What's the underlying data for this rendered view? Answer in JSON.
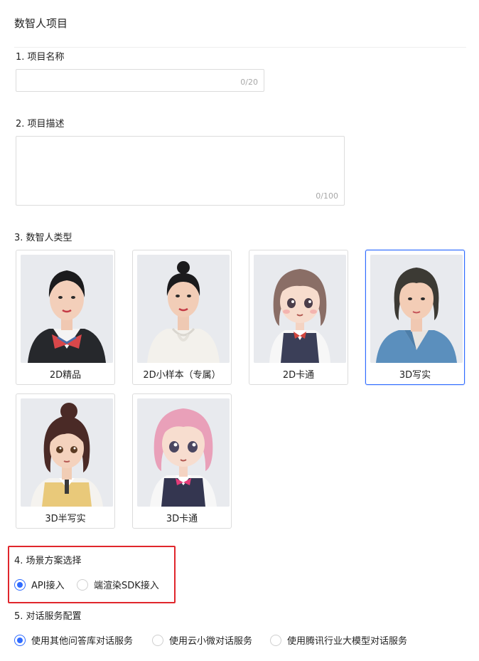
{
  "page": {
    "title": "数智人项目"
  },
  "project_name": {
    "label": "1. 项目名称",
    "value": "",
    "counter": "0/20"
  },
  "project_desc": {
    "label": "2. 项目描述",
    "value": "",
    "counter": "0/100"
  },
  "avatar_type": {
    "label": "3. 数智人类型",
    "selected": "3D写实",
    "options": [
      {
        "label": "2D精品"
      },
      {
        "label": "2D小样本（专属）"
      },
      {
        "label": "2D卡通"
      },
      {
        "label": "3D写实"
      },
      {
        "label": "3D半写实"
      },
      {
        "label": "3D卡通"
      }
    ]
  },
  "scene": {
    "label": "4. 场景方案选择",
    "selected": "API接入",
    "options": [
      {
        "label": "API接入"
      },
      {
        "label": "端渲染SDK接入"
      }
    ]
  },
  "dialog_service": {
    "label": "5. 对话服务配置",
    "selected": "使用其他问答库对话服务",
    "options": [
      {
        "label": "使用其他问答库对话服务"
      },
      {
        "label": "使用云小微对话服务"
      },
      {
        "label": "使用腾讯行业大模型对话服务"
      }
    ]
  },
  "colors": {
    "accent": "#2f6bff",
    "highlight_border": "#e0262c"
  }
}
